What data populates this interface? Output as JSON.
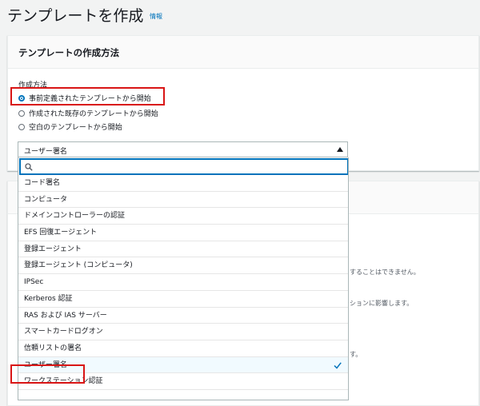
{
  "page": {
    "title": "テンプレートを作成",
    "info_link": "情報"
  },
  "method_panel": {
    "title": "テンプレートの作成方法",
    "field_label": "作成方法",
    "options": [
      {
        "label": "事前定義されたテンプレートから開始",
        "checked": true
      },
      {
        "label": "作成された既存のテンプレートから開始",
        "checked": false
      },
      {
        "label": "空白のテンプレートから開始",
        "checked": false
      }
    ]
  },
  "template_select": {
    "value": "ユーザー署名",
    "search_placeholder": "",
    "options": [
      "コード署名",
      "コンピュータ",
      "ドメインコントローラーの認証",
      "EFS 回復エージェント",
      "登録エージェント",
      "登録エージェント (コンピュータ)",
      "IPSec",
      "Kerberos 認証",
      "RAS および IAS サーバー",
      "スマートカードログオン",
      "信頼リストの署名",
      "ユーザー署名",
      "ワークステーション認証"
    ],
    "selected_index": 11
  },
  "background_panel": {
    "fragments": [
      "することはできません。",
      "ションに影響します。",
      "す。"
    ]
  },
  "colors": {
    "accent": "#0073bb",
    "highlight": "#d91515",
    "selected_row": "#f1faff"
  },
  "icons": {
    "search": "search-icon",
    "check": "check-icon",
    "caret": "caret-up-icon"
  }
}
